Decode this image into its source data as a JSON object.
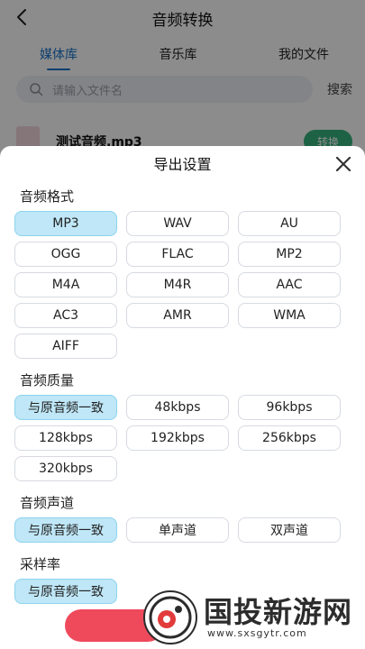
{
  "header": {
    "title": "音频转换"
  },
  "tabs": [
    {
      "label": "媒体库",
      "active": true
    },
    {
      "label": "音乐库",
      "active": false
    },
    {
      "label": "我的文件",
      "active": false
    }
  ],
  "search": {
    "placeholder": "请输入文件名",
    "button": "搜索"
  },
  "file": {
    "name": "测试音频.mp3",
    "action": "转换"
  },
  "sheet": {
    "title": "导出设置",
    "sections": [
      {
        "title": "音频格式",
        "options": [
          "MP3",
          "WAV",
          "AU",
          "OGG",
          "FLAC",
          "MP2",
          "M4A",
          "M4R",
          "AAC",
          "AC3",
          "AMR",
          "WMA",
          "AIFF"
        ],
        "selected": 0
      },
      {
        "title": "音频质量",
        "options": [
          "与原音频一致",
          "48kbps",
          "96kbps",
          "128kbps",
          "192kbps",
          "256kbps",
          "320kbps"
        ],
        "selected": 0
      },
      {
        "title": "音频声道",
        "options": [
          "与原音频一致",
          "单声道",
          "双声道"
        ],
        "selected": 0
      },
      {
        "title": "采样率",
        "options": [
          "与原音频一致"
        ],
        "selected": 0
      }
    ]
  },
  "watermark": {
    "text": "国投新游网",
    "url": "www.sxsgytr.com"
  },
  "colors": {
    "accent": "#1a73c9",
    "selected_chip": "#bfe7f7",
    "confirm": "#ee4a5c"
  }
}
